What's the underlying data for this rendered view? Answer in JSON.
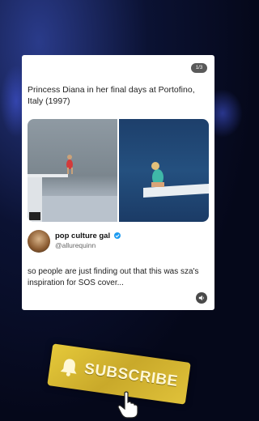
{
  "post": {
    "counter": "1/3",
    "caption": "Princess Diana in her final days at Portofino, Italy (1997)"
  },
  "tweet": {
    "display_name": "pop culture gal",
    "handle": "@allurequinn",
    "text": "so people are just finding out that this was sza's inspiration for SOS cover..."
  },
  "overlay": {
    "subscribe_label": "SUBSCRIBE"
  },
  "colors": {
    "verified": "#1d9bf0",
    "subscribe_bg": "#d9b930",
    "background": "#06091c"
  }
}
